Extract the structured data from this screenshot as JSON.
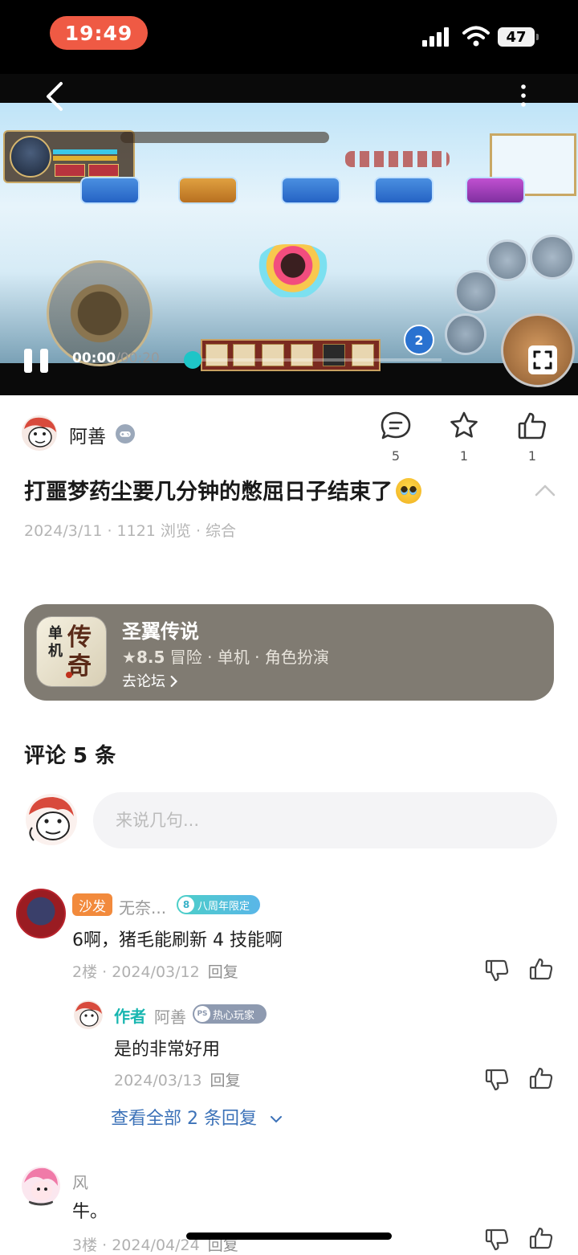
{
  "status_bar": {
    "time": "19:49",
    "battery": "47"
  },
  "video": {
    "current_time": "00:00",
    "duration": "/00:20",
    "progress": 0.0,
    "icons": [
      "back-icon",
      "more-icon",
      "pause-icon",
      "fullscreen-icon"
    ],
    "accent_color": "#1ec5c7"
  },
  "post": {
    "author": "阿善",
    "title": "打噩梦药尘要几分钟的憋屈日子结束了",
    "meta": "2024/3/11 · 1121 浏览 · 综合",
    "comment_count": "5",
    "favorite_count": "1",
    "like_count": "1"
  },
  "game_card": {
    "name": "圣翼传说",
    "score": "8.5",
    "tags": "冒险 · 单机 · 角色扮演",
    "link": "去论坛",
    "background": "#807b72"
  },
  "comments": {
    "title": "评论 5 条",
    "input_placeholder": "来说几句...",
    "items": [
      {
        "tag": "沙发",
        "name": "无奈...",
        "badge": "八周年限定",
        "text": "6啊，猪毛能刷新 4 技能啊",
        "floor_date": "2楼 · 2024/03/12",
        "reply_label": "回复",
        "replies": [
          {
            "author_tag": "作者",
            "name": "阿善",
            "badge": "热心玩家",
            "text": "是的非常好用",
            "date": "2024/03/13",
            "reply_label": "回复"
          }
        ],
        "view_all": "查看全部 2 条回复"
      },
      {
        "name": "风",
        "text": "牛。",
        "floor_date": "3楼 · 2024/04/24",
        "reply_label": "回复"
      }
    ]
  }
}
